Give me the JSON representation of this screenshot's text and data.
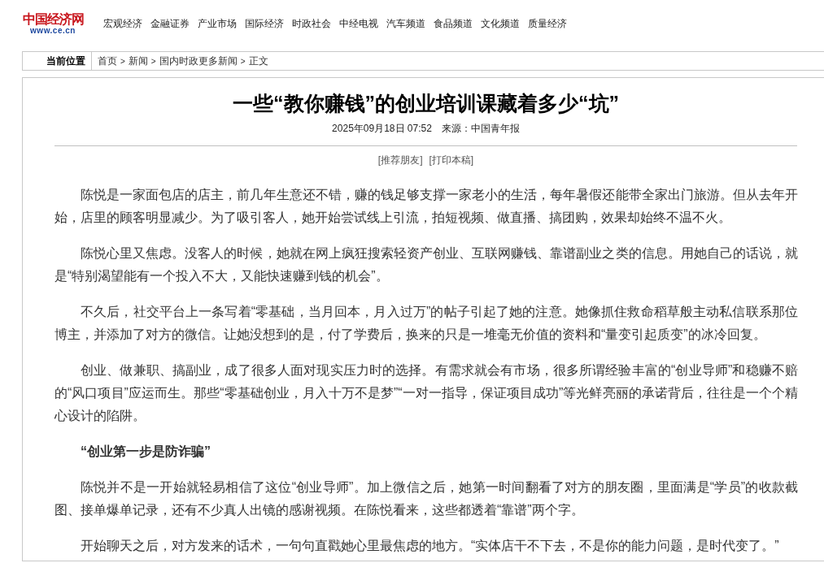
{
  "logo": {
    "name": "中国经济网",
    "url": "www.ce.cn"
  },
  "nav": [
    "宏观经济",
    "金融证券",
    "产业市场",
    "国际经济",
    "时政社会",
    "中经电视",
    "汽车频道",
    "食品频道",
    "文化频道",
    "质量经济"
  ],
  "breadcrumb": {
    "label": "当前位置",
    "items": [
      "首页",
      "新闻",
      "国内时政更多新闻",
      "正文"
    ],
    "separator": ">"
  },
  "article": {
    "title": "一些“教你赚钱”的创业培训课藏着多少“坑”",
    "date": "2025年09月18日 07:52",
    "source": "来源：中国青年报",
    "tools": [
      "[推荐朋友]",
      "[打印本稿]"
    ],
    "paragraphs": [
      {
        "kind": "text",
        "text": "陈悦是一家面包店的店主，前几年生意还不错，赚的钱足够支撑一家老小的生活，每年暑假还能带全家出门旅游。但从去年开始，店里的顾客明显减少。为了吸引客人，她开始尝试线上引流，拍短视频、做直播、搞团购，效果却始终不温不火。"
      },
      {
        "kind": "text",
        "text": "陈悦心里又焦虑。没客人的时候，她就在网上疯狂搜索轻资产创业、互联网赚钱、靠谱副业之类的信息。用她自己的话说，就是“特别渴望能有一个投入不大，又能快速赚到钱的机会”。"
      },
      {
        "kind": "text",
        "text": "不久后，社交平台上一条写着“零基础，当月回本，月入过万”的帖子引起了她的注意。她像抓住救命稻草般主动私信联系那位博主，并添加了对方的微信。让她没想到的是，付了学费后，换来的只是一堆毫无价值的资料和“量变引起质变”的冰冷回复。"
      },
      {
        "kind": "text",
        "text": "创业、做兼职、搞副业，成了很多人面对现实压力时的选择。有需求就会有市场，很多所谓经验丰富的“创业导师”和稳赚不赔的“风口项目”应运而生。那些“零基础创业，月入十万不是梦”“一对一指导，保证项目成功”等光鲜亮丽的承诺背后，往往是一个个精心设计的陷阱。"
      },
      {
        "kind": "heading",
        "text": "“创业第一步是防诈骗”"
      },
      {
        "kind": "text",
        "text": "陈悦并不是一开始就轻易相信了这位“创业导师”。加上微信之后，她第一时间翻看了对方的朋友圈，里面满是“学员”的收款截图、接单爆单记录，还有不少真人出镜的感谢视频。在陈悦看来，这些都透着“靠谱”两个字。"
      },
      {
        "kind": "text",
        "text": "开始聊天之后，对方发来的话术，一句句直戳她心里最焦虑的地方。“实体店干不下去，不是你的能力问题，是时代变了。”"
      }
    ]
  }
}
